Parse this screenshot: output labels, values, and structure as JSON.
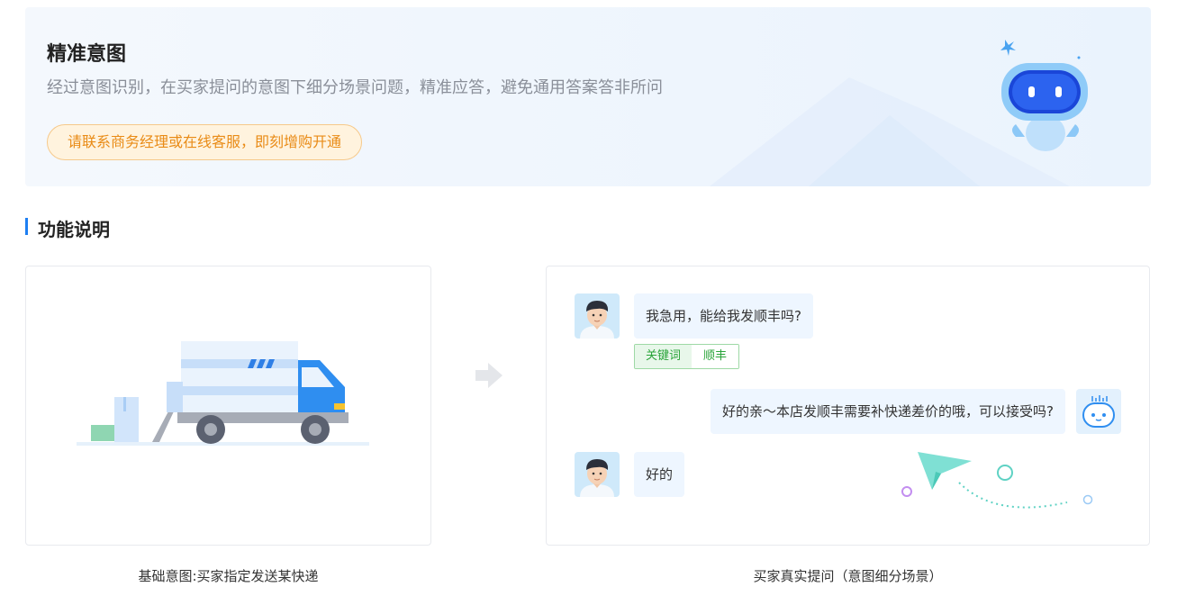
{
  "banner": {
    "title": "精准意图",
    "subtitle": "经过意图识别，在买家提问的意图下细分场景问题，精准应答，避免通用答案答非所问",
    "cta_label": "请联系商务经理或在线客服，即刻增购开通"
  },
  "section": {
    "title": "功能说明"
  },
  "left_card": {
    "caption": "基础意图:买家指定发送某快递"
  },
  "right_card": {
    "caption": "买家真实提问（意图细分场景）",
    "messages": [
      {
        "from": "buyer",
        "text": "我急用，能给我发顺丰吗?"
      },
      {
        "from": "bot",
        "text": "好的亲～本店发顺丰需要补快递差价的哦，可以接受吗?"
      },
      {
        "from": "buyer",
        "text": "好的"
      }
    ],
    "keyword_tag": {
      "label": "关键词",
      "value": "顺丰"
    }
  },
  "colors": {
    "accent": "#1e7ff2",
    "cta_text": "#e98b16",
    "tag_green": "#2aa43a"
  }
}
